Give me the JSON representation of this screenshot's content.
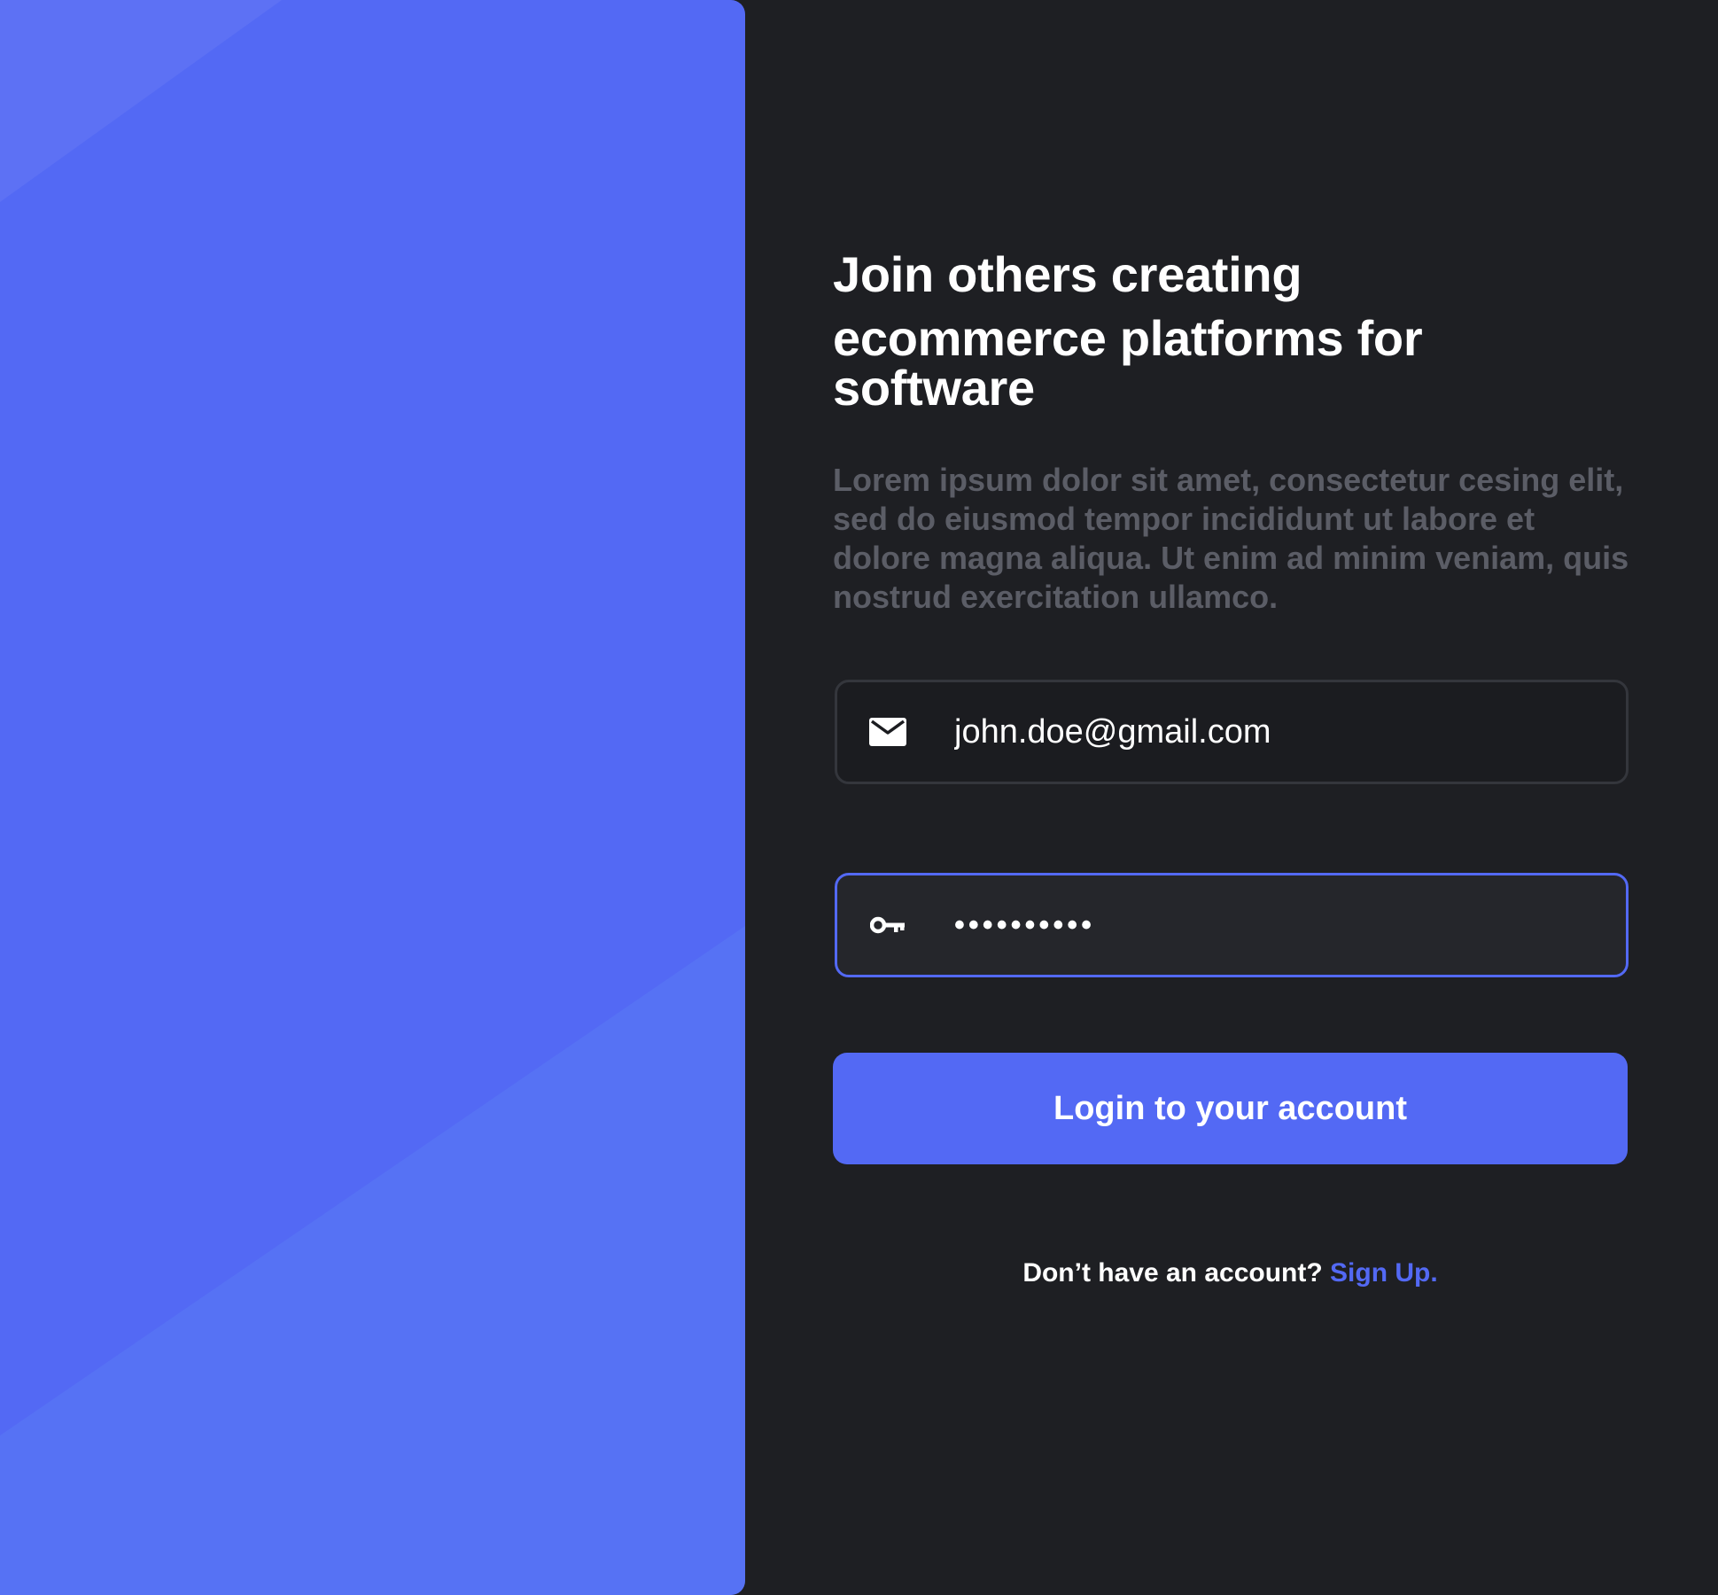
{
  "hero": {
    "color": "#5369f4"
  },
  "headline": {
    "line1": "Join others creating",
    "line2": "ecommerce platforms for software"
  },
  "description": "Lorem ipsum dolor sit amet, consectetur cesing elit, sed do eiusmod tempor incididunt ut labore et dolore magna aliqua. Ut enim ad minim veniam, quis nostrud exercitation ullamco.",
  "form": {
    "email": {
      "icon": "mail-icon",
      "value": "john.doe@gmail.com"
    },
    "password": {
      "icon": "key-icon",
      "value": "••••••••••"
    },
    "login_label": "Login to your account"
  },
  "signup": {
    "prompt": "Don’t have an account?",
    "link_label": "Sign Up."
  },
  "colors": {
    "background": "#1e1f23",
    "accent": "#5369f4",
    "muted_text": "#5b5d66"
  }
}
